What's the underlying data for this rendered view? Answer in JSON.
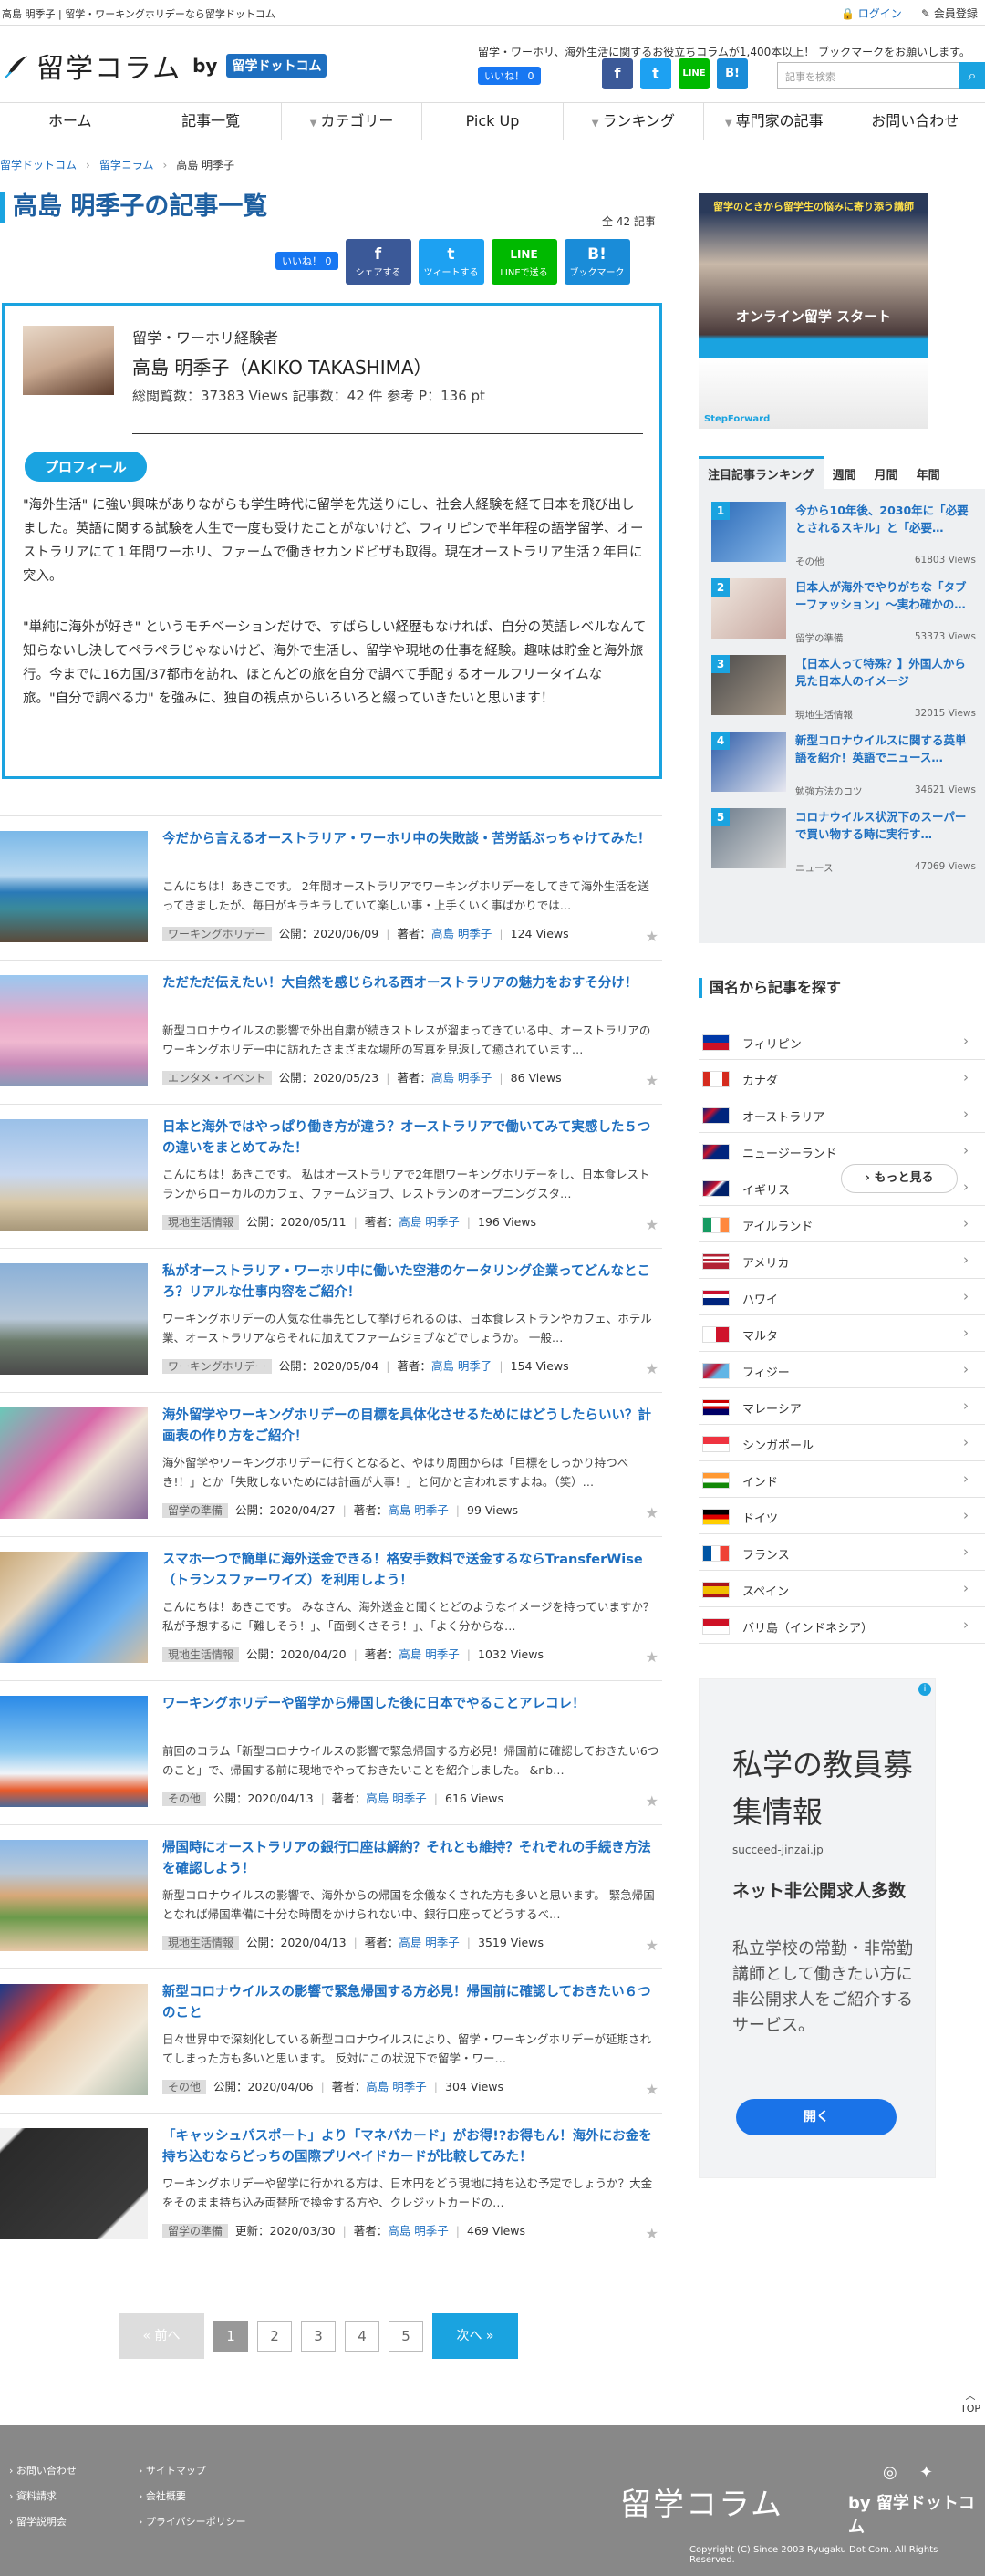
{
  "topbar": {
    "title": "高島 明季子 | 留学・ワーキングホリデーなら留学ドットコム",
    "login": "ログイン",
    "register": "会員登録"
  },
  "header": {
    "logo_name": "留学コラム",
    "logo_by": "by",
    "logo_brand": "留学ドットコム",
    "tagline": "留学・ワーホリ、海外生活に関するお役立ちコラムが1,400本以上！ ブックマークをお願いします。",
    "like": "いいね！ 0",
    "search_placeholder": "記事を検索",
    "sns": [
      "f",
      "t",
      "LINE",
      "B!"
    ]
  },
  "nav": [
    {
      "label": "ホーム",
      "dd": false
    },
    {
      "label": "記事一覧",
      "dd": false
    },
    {
      "label": "カテゴリー",
      "dd": true
    },
    {
      "label": "Pick Up",
      "dd": false
    },
    {
      "label": "ランキング",
      "dd": true
    },
    {
      "label": "専門家の記事",
      "dd": true
    },
    {
      "label": "お問い合わせ",
      "dd": false
    }
  ],
  "breadcrumb": [
    "留学ドットコム",
    "留学コラム",
    "高島 明季子"
  ],
  "page": {
    "title": "高島 明季子の記事一覧",
    "total": "全 42 記事",
    "like": "いいね！ 0",
    "share": [
      {
        "icon": "f",
        "label": "シェアする",
        "color": "#3b5998"
      },
      {
        "icon": "t",
        "label": "ツィートする",
        "color": "#1da1f2"
      },
      {
        "icon": "LINE",
        "label": "LINEで送る",
        "color": "#00b900"
      },
      {
        "icon": "B!",
        "label": "ブックマーク",
        "color": "#1a8cd8"
      }
    ]
  },
  "profile": {
    "role": "留学・ワーホリ経験者",
    "name": "高島 明季子（AKIKO TAKASHIMA）",
    "stats": "総閲覧数：37383 Views 記事数：42 件 参考 P：136 pt",
    "button": "プロフィール",
    "bio1": "\"海外生活\" に強い興味がありながらも学生時代に留学を先送りにし、社会人経験を経て日本を飛び出しました。英語に関する試験を人生で一度も受けたことがないけど、フィリピンで半年程の語学留学、オーストラリアにて１年間ワーホリ、ファームで働きセカンドビザも取得。現在オーストラリア生活２年目に突入。",
    "bio2": "\"単純に海外が好き\" というモチベーションだけで、すばらしい経歴もなければ、自分の英語レベルなんて知らないし決してペラペラじゃないけど、海外で生活し、留学や現地の仕事を経験。趣味は貯金と海外旅行。今までに16カ国/37都市を訪れ、ほとんどの旅を自分で調べて手配するオールフリータイムな旅。\"自分で調べる力\" を強みに、独自の視点からいろいろと綴っていきたいと思います！"
  },
  "articles": [
    {
      "title": "今だから言えるオーストラリア・ワーホリ中の失敗談・苦労話ぶっちゃけてみた！",
      "excerpt": "こんにちは！あきこです。 2年間オーストラリアでワーキングホリデーをしてきて海外生活を送ってきましたが、毎日がキラキラしていて楽しい事・上手くいく事ばかりでは…",
      "cat": "ワーキングホリデー",
      "date": "公開：2020/06/09",
      "author_label": "著者：",
      "author": "高島 明季子",
      "views": "124 Views",
      "bg": "linear-gradient(180deg,#7ab8e8 0%,#b8d8f0 40%,#2a7ab8 55%,#3a8a9a 70%,#5a4a3a 100%)"
    },
    {
      "title": "ただただ伝えたい！大自然を感じられる西オーストラリアの魅力をおすそ分け！",
      "excerpt": "新型コロナウイルスの影響で外出自粛が続きストレスが溜まってきている中、オーストラリアのワーキングホリデー中に訪れたさまざまな場所の写真を見返して癒されています…",
      "cat": "エンタメ・イベント",
      "date": "公開：2020/05/23",
      "author_label": "著者：",
      "author": "高島 明季子",
      "views": "86 Views",
      "bg": "linear-gradient(180deg,#9ac8f0 0%,#e8a8c8 40%,#f0b8d0 60%,#c88ab8 80%,#8a9ab8 100%)"
    },
    {
      "title": "日本と海外ではやっぱり働き方が違う？オーストラリアで働いてみて実感した５つの違いをまとめてみた！",
      "excerpt": "こんにちは！あきこです。 私はオーストラリアで2年間ワーキングホリデーをし、日本食レストランからローカルのカフェ、ファームジョブ、レストランのオープニングスタ…",
      "cat": "現地生活情報",
      "date": "公開：2020/05/11",
      "author_label": "著者：",
      "author": "高島 明季子",
      "views": "196 Views",
      "bg": "linear-gradient(180deg,#9ac0e8 0%,#c8d8f0 50%,#d8c8a8 75%,#a8987a 100%)"
    },
    {
      "title": "私がオーストラリア・ワーホリ中に働いた空港のケータリング企業ってどんなところ？リアルな仕事内容をご紹介！",
      "excerpt": "ワーキングホリデーの人気な仕事先として挙げられるのは、日本食レストランやカフェ、ホテル業、オーストラリアならそれに加えてファームジョブなどでしょうか。 一般…",
      "cat": "ワーキングホリデー",
      "date": "公開：2020/05/04",
      "author_label": "著者：",
      "author": "高島 明季子",
      "views": "154 Views",
      "bg": "linear-gradient(180deg,#8ab0d8 0%,#b8c8d8 50%,#6a7a6a 70%,#4a4a4a 100%)"
    },
    {
      "title": "海外留学やワーキングホリデーの目標を具体化させるためにはどうしたらいい？計画表の作り方をご紹介！",
      "excerpt": "海外留学やワーキングホリデーに行くとなると、やはり周囲からは「目標をしっかり持つべき!！」とか「失敗しないためには計画が大事！」と何かと言われますよね。（笑）…",
      "cat": "留学の準備",
      "date": "公開：2020/04/27",
      "author_label": "著者：",
      "author": "高島 明季子",
      "views": "99 Views",
      "bg": "linear-gradient(135deg,#6ac8b8 0%,#d868a8 40%,#f0e8d8 60%,#8a6a9a 100%)"
    },
    {
      "title": "スマホ一つで簡単に海外送金できる！格安手数料で送金するならTransferWise（トランスファーワイズ）を利用しよう！",
      "excerpt": "こんにちは！あきこです。 みなさん、海外送金と聞くとどのようなイメージを持っていますか？ 私が予想するに「難しそう！」、「面倒くさそう！」、「よく分からな…",
      "cat": "現地生活情報",
      "date": "公開：2020/04/20",
      "author_label": "著者：",
      "author": "高島 明季子",
      "views": "1032 Views",
      "bg": "linear-gradient(135deg,#c8a878 0%,#e8d8c0 30%,#3a8ae0 50%,#6ab0f0 70%,#d8c0a0 100%)"
    },
    {
      "title": "ワーキングホリデーや留学から帰国した後に日本でやることアレコレ！",
      "excerpt": "前回のコラム「新型コロナウイルスの影響で緊急帰国する方必見！帰国前に確認しておきたい6つのこと」で、帰国する前に現地でやっておきたいことを紹介しました。 &nb…",
      "cat": "その他",
      "date": "公開：2020/04/13",
      "author_label": "著者：",
      "author": "高島 明季子",
      "views": "616 Views",
      "bg": "linear-gradient(180deg,#2a8ae8 0%,#8ac8f0 50%,#f0f4f8 70%,#e85a2a 85%,#4a6a9a 100%)"
    },
    {
      "title": "帰国時にオーストラリアの銀行口座は解約？それとも維持？それぞれの手続き方法を確認しよう！",
      "excerpt": "新型コロナウイルスの影響で、海外からの帰国を余儀なくされた方も多いと思います。 緊急帰国となれば帰国準備に十分な時間をかけられない中、銀行口座ってどうするべ…",
      "cat": "現地生活情報",
      "date": "公開：2020/04/13",
      "author_label": "著者：",
      "author": "高島 明季子",
      "views": "3519 Views",
      "bg": "linear-gradient(180deg,#8ab8e8 0%,#b8c8d8 30%,#d8a878 50%,#6a9a4a 70%,#e8c8a8 100%)"
    },
    {
      "title": "新型コロナウイルスの影響で緊急帰国する方必見！帰国前に確認しておきたい６つのこと",
      "excerpt": "日々世界中で深刻化している新型コロナウイルスにより、留学・ワーキングホリデーが延期されてしまった方も多いと思います。 反対にこの状況下で留学・ワー…",
      "cat": "その他",
      "date": "公開：2020/04/06",
      "author_label": "著者：",
      "author": "高島 明季子",
      "views": "304 Views",
      "bg": "linear-gradient(135deg,#1a3a8a 0%,#c83a3a 25%,#e8c8a8 40%,#f0e8d8 70%,#a8b8a8 100%)"
    },
    {
      "title": "「キャッシュパスポート」より「マネパカード」がお得!?お得もん！海外にお金を持ち込むならどっちの国際プリペイドカードが比較してみた！",
      "excerpt": "ワーキングホリデーや留学に行かれる方は、日本円をどう現地に持ち込む予定でしょうか？大金をそのまま持ち込み両替所で換金する方や、クレジットカードの…",
      "cat": "留学の準備",
      "date": "更新：2020/03/30",
      "author_label": "著者：",
      "author": "高島 明季子",
      "views": "469 Views",
      "bg": "linear-gradient(135deg,#f0f0f0 0%,#f0f0f0 8%,#2a2a2a 10%,#3a3a3a 80%,#f0f0f0 82%,#f0f0f0 100%)"
    }
  ],
  "pager": {
    "prev": "« 前へ",
    "pages": [
      "1",
      "2",
      "3",
      "4",
      "5"
    ],
    "next": "次へ »"
  },
  "sidebar": {
    "ad_top_line1": "留学のときから留学生の悩みに寄り添う講師",
    "ad_top_line2": "オンライン留学 スタート",
    "ad_top_line3": "StepForward",
    "ranking_tabs": [
      "注目記事ランキング",
      "週間",
      "月間",
      "年間"
    ],
    "ranking": [
      {
        "n": "1",
        "title": "今から10年後、2030年に「必要とされるスキル」と「必要…",
        "cat": "その他",
        "views": "61803 Views",
        "bg": "linear-gradient(135deg,#2a6ab8,#8ab8e8)"
      },
      {
        "n": "2",
        "title": "日本人が海外でやりがちな「タブーファッション」〜実わ確かの…",
        "cat": "留学の準備",
        "views": "53373 Views",
        "bg": "linear-gradient(135deg,#f0e8e0,#c8a8a0)"
      },
      {
        "n": "3",
        "title": "【日本人って特殊？】外国人から見た日本人のイメージ",
        "cat": "現地生活情報",
        "views": "32015 Views",
        "bg": "linear-gradient(135deg,#4a4a4a,#a89a8a)"
      },
      {
        "n": "4",
        "title": "新型コロナウイルスに関する英単語を紹介！英語でニュース…",
        "cat": "勉強方法のコツ",
        "views": "34621 Views",
        "bg": "linear-gradient(135deg,#2a5aa8,#e8e8f0)"
      },
      {
        "n": "5",
        "title": "コロナウイルス状況下のスーパーで買い物する時に実行す…",
        "cat": "ニュース",
        "views": "47069 Views",
        "bg": "linear-gradient(135deg,#6a7a8a,#d8d8d8)"
      }
    ],
    "more": "もっと見る",
    "country_head": "国名から記事を探す",
    "countries": [
      {
        "name": "フィリピン",
        "flag": "linear-gradient(180deg,#0038a8 50%,#ce1126 50%)"
      },
      {
        "name": "カナダ",
        "flag": "linear-gradient(90deg,#d52b1e 25%,#fff 25%,#fff 75%,#d52b1e 75%)"
      },
      {
        "name": "オーストラリア",
        "flag": "linear-gradient(135deg,#00247d,#c8102e 30%,#00247d 50%)"
      },
      {
        "name": "ニュージーランド",
        "flag": "linear-gradient(135deg,#00247d,#cc142b 30%,#00247d 50%)"
      },
      {
        "name": "イギリス",
        "flag": "linear-gradient(135deg,#012169,#c8102e 40%,#fff 50%,#012169 60%)"
      },
      {
        "name": "アイルランド",
        "flag": "linear-gradient(90deg,#169b62 33%,#fff 33%,#fff 66%,#ff883e 66%)"
      },
      {
        "name": "アメリカ",
        "flag": "linear-gradient(180deg,#b22234 15%,#fff 15%,#fff 30%,#b22234 30%,#b22234 45%,#fff 45%,#fff 60%,#b22234 60%)"
      },
      {
        "name": "ハワイ",
        "flag": "linear-gradient(180deg,#c8102e 25%,#fff 25%,#fff 50%,#00247d 50%)"
      },
      {
        "name": "マルタ",
        "flag": "linear-gradient(90deg,#fff 50%,#cf142b 50%)"
      },
      {
        "name": "フィジー",
        "flag": "linear-gradient(135deg,#62b5e5,#c8102e 40%,#62b5e5 60%)"
      },
      {
        "name": "マレーシア",
        "flag": "linear-gradient(180deg,#cc0001 20%,#fff 20%,#fff 40%,#cc0001 40%,#cc0001 60%,#010066 60%)"
      },
      {
        "name": "シンガポール",
        "flag": "linear-gradient(180deg,#ef3340 50%,#fff 50%)"
      },
      {
        "name": "インド",
        "flag": "linear-gradient(180deg,#ff9933 33%,#fff 33%,#fff 66%,#138808 66%)"
      },
      {
        "name": "ドイツ",
        "flag": "linear-gradient(180deg,#000 33%,#dd0000 33%,#dd0000 66%,#ffce00 66%)"
      },
      {
        "name": "フランス",
        "flag": "linear-gradient(90deg,#0055a4 33%,#fff 33%,#fff 66%,#ef4135 66%)"
      },
      {
        "name": "スペイン",
        "flag": "linear-gradient(180deg,#aa151b 25%,#f1bf00 25%,#f1bf00 75%,#aa151b 75%)"
      },
      {
        "name": "バリ島（インドネシア）",
        "flag": "linear-gradient(180deg,#ce1126 50%,#fff 50%)"
      }
    ],
    "ad2": {
      "headline": "私学の教員募集情報",
      "url": "succeed-jinzai.jp",
      "sub": "ネット非公開求人多数",
      "body": "私立学校の常勤・非常勤講師として働きたい方に非公開求人をご紹介するサービス。",
      "button": "開く"
    }
  },
  "totop": "TOP",
  "footer": {
    "links_col1": [
      "お問い合わせ",
      "資料請求",
      "留学説明会"
    ],
    "links_col2": [
      "サイトマップ",
      "会社概要",
      "プライバシーポリシー"
    ],
    "logo": "留学コラム",
    "logo_by": "by 留学ドットコム",
    "copyright": "Copyright (C) Since 2003 Ryugaku Dot Com. All Rights Reserved."
  }
}
